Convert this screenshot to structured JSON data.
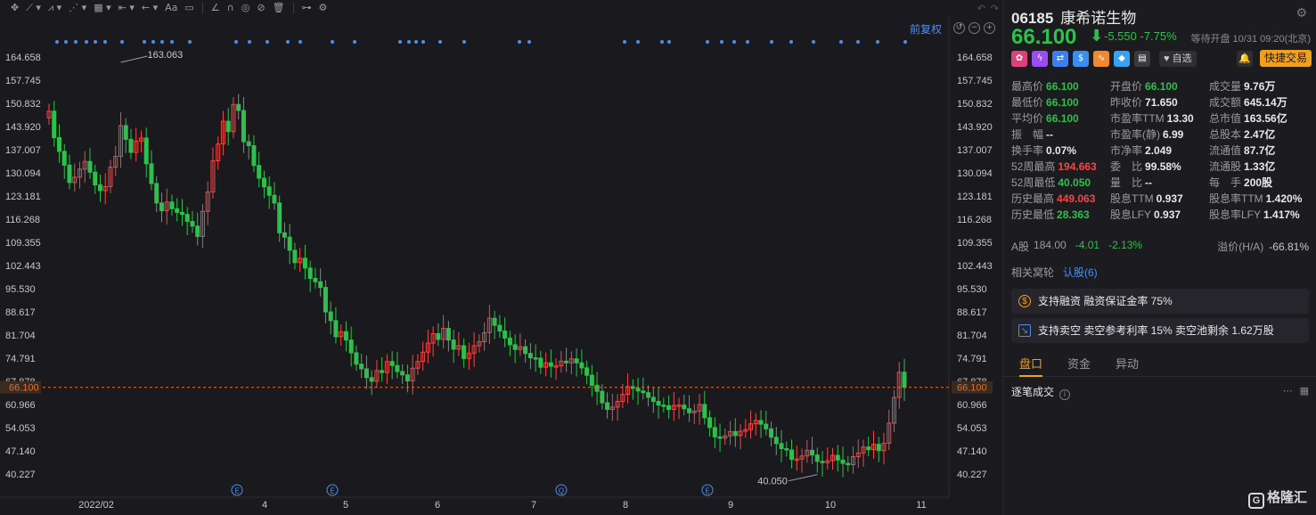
{
  "toolbar": {
    "tools": [
      "✥",
      "⟋ ▾",
      "⩘ ▾",
      "⋰ ▾",
      "▦ ▾",
      "⇤ ▾",
      "← ▾",
      "Aa",
      "▭",
      "∠",
      "∩",
      "◎",
      "⊘",
      "🗑",
      "⊶",
      "⚙"
    ],
    "undo": "↶",
    "redo": "↷"
  },
  "chart": {
    "adjust_label": "前复权",
    "controls": [
      "↺",
      "−",
      "+"
    ],
    "price_ticks": [
      "164.658",
      "157.745",
      "150.832",
      "143.920",
      "137.007",
      "130.094",
      "123.181",
      "116.268",
      "109.355",
      "102.443",
      "95.530",
      "88.617",
      "81.704",
      "74.791",
      "67.878",
      "60.966",
      "54.053",
      "47.140",
      "40.227"
    ],
    "current_price_tag": "66.100",
    "high_label": "163.063",
    "low_label": "40.050",
    "date_labels": [
      "2022/02",
      "4",
      "5",
      "6",
      "7",
      "8",
      "9",
      "10",
      "11"
    ],
    "event_markers": [
      "E",
      "E",
      "Q",
      "E"
    ],
    "colors": {
      "up": "#f04848",
      "down": "#2fbf4d",
      "dot": "#4d8ef0",
      "price_line": "#e07030"
    }
  },
  "chart_data": {
    "type": "candlestick",
    "title": "",
    "ylim": [
      40.227,
      164.658
    ],
    "x_ticks": [
      "2022/02",
      "4",
      "5",
      "6",
      "7",
      "8",
      "9",
      "10",
      "11"
    ],
    "annotations": [
      {
        "label": "163.063",
        "type": "max"
      },
      {
        "label": "40.050",
        "type": "min"
      }
    ],
    "last_price": 66.1,
    "closes": [
      148.5,
      140.6,
      136.5,
      132.4,
      127.2,
      128.8,
      131.2,
      133.5,
      130.3,
      126.5,
      124.8,
      126.0,
      131.8,
      135.0,
      144.2,
      140.1,
      136.2,
      139.6,
      140.5,
      132.8,
      126.9,
      121.1,
      118.8,
      121.4,
      119.4,
      118.3,
      117.7,
      115.6,
      114.2,
      111.1,
      118.6,
      124.4,
      133.7,
      138.7,
      145.5,
      142.4,
      150.5,
      148.7,
      139.4,
      138.2,
      132.3,
      128.5,
      125.9,
      123.4,
      121.1,
      112.2,
      110.9,
      107.0,
      103.3,
      104.6,
      101.7,
      98.6,
      97.6,
      95.9,
      88.6,
      86.0,
      81.2,
      82.7,
      80.2,
      76.4,
      73.0,
      71.6,
      69.0,
      67.9,
      71.1,
      70.5,
      73.8,
      72.6,
      70.8,
      69.8,
      68.0,
      71.8,
      73.8,
      76.6,
      79.3,
      82.1,
      80.4,
      83.7,
      80.2,
      77.5,
      78.5,
      74.7,
      76.3,
      78.5,
      79.7,
      82.4,
      86.7,
      84.6,
      82.9,
      80.8,
      78.8,
      77.4,
      78.2,
      76.2,
      74.9,
      74.8,
      72.1,
      73.4,
      72.4,
      72.5,
      73.9,
      73.4,
      74.6,
      73.4,
      71.9,
      69.7,
      66.7,
      64.9,
      61.5,
      59.5,
      60.2,
      61.9,
      64.0,
      66.3,
      65.8,
      65.0,
      64.5,
      63.1,
      61.9,
      60.8,
      60.6,
      59.5,
      60.7,
      60.8,
      59.7,
      58.5,
      59.0,
      61.0,
      57.0,
      54.1,
      51.3,
      50.9,
      51.6,
      52.9,
      51.7,
      53.0,
      53.5,
      55.2,
      56.2,
      55.1,
      53.7,
      51.2,
      49.3,
      47.8,
      47.4,
      44.6,
      44.7,
      45.6,
      47.3,
      45.9,
      44.0,
      43.6,
      44.2,
      45.8,
      44.4,
      43.4,
      43.0,
      45.4,
      46.5,
      48.3,
      47.5,
      49.1,
      47.2,
      49.4,
      55.4,
      63.1,
      70.6,
      66.1
    ]
  },
  "panel": {
    "code": "06185",
    "name": "康希诺生物",
    "price": "66.100",
    "change": "-5.550",
    "change_pct": "-7.75%",
    "status": "等待开盘 10/31 09:20(北京)",
    "fav_label": "自选",
    "quick_trade_label": "快捷交易",
    "icons": [
      "hk-icon",
      "lightning-icon",
      "shuffle-icon",
      "dollar-icon",
      "chart-icon",
      "tag-icon",
      "doc-icon"
    ],
    "stats": [
      [
        {
          "label": "最高价",
          "value": "66.100",
          "tone": "dn"
        },
        {
          "label": "开盘价",
          "value": "66.100",
          "tone": "dn"
        },
        {
          "label": "成交量",
          "value": "9.76万",
          "tone": ""
        }
      ],
      [
        {
          "label": "最低价",
          "value": "66.100",
          "tone": "dn"
        },
        {
          "label": "昨收价",
          "value": "71.650",
          "tone": ""
        },
        {
          "label": "成交额",
          "value": "645.14万",
          "tone": ""
        }
      ],
      [
        {
          "label": "平均价",
          "value": "66.100",
          "tone": "dn"
        },
        {
          "label": "市盈率TTM",
          "value": "13.30",
          "tone": ""
        },
        {
          "label": "总市值",
          "value": "163.56亿",
          "tone": ""
        }
      ],
      [
        {
          "label": "振　幅",
          "value": "--",
          "tone": ""
        },
        {
          "label": "市盈率(静)",
          "value": "6.99",
          "tone": ""
        },
        {
          "label": "总股本",
          "value": "2.47亿",
          "tone": ""
        }
      ],
      [
        {
          "label": "换手率",
          "value": "0.07%",
          "tone": ""
        },
        {
          "label": "市净率",
          "value": "2.049",
          "tone": ""
        },
        {
          "label": "流通值",
          "value": "87.7亿",
          "tone": ""
        }
      ],
      [
        {
          "label": "52周最高",
          "value": "194.663",
          "tone": "up"
        },
        {
          "label": "委　比",
          "value": "99.58%",
          "tone": ""
        },
        {
          "label": "流通股",
          "value": "1.33亿",
          "tone": ""
        }
      ],
      [
        {
          "label": "52周最低",
          "value": "40.050",
          "tone": "dn"
        },
        {
          "label": "量　比",
          "value": "--",
          "tone": ""
        },
        {
          "label": "每　手",
          "value": "200股",
          "tone": ""
        }
      ],
      [
        {
          "label": "历史最高",
          "value": "449.063",
          "tone": "up"
        },
        {
          "label": "股息TTM",
          "value": "0.937",
          "tone": ""
        },
        {
          "label": "股息率TTM",
          "value": "1.420%",
          "tone": ""
        }
      ],
      [
        {
          "label": "历史最低",
          "value": "28.363",
          "tone": "dn"
        },
        {
          "label": "股息LFY",
          "value": "0.937",
          "tone": ""
        },
        {
          "label": "股息率LFY",
          "value": "1.417%",
          "tone": ""
        }
      ]
    ],
    "a_share": {
      "label": "A股",
      "price": "184.00",
      "change": "-4.01",
      "change_pct": "-2.13%",
      "premium_label": "溢价(H/A)",
      "premium": "-66.81%"
    },
    "related": {
      "label": "相关窝轮",
      "link": "认股(6)"
    },
    "margin_card": "支持融资 融资保证金率 75%",
    "short_card": "支持卖空 卖空参考利率 15% 卖空池剩余 1.62万股",
    "tabs": [
      "盘口",
      "资金",
      "异动"
    ],
    "tick_title": "逐笔成交",
    "logo": "格隆汇"
  }
}
